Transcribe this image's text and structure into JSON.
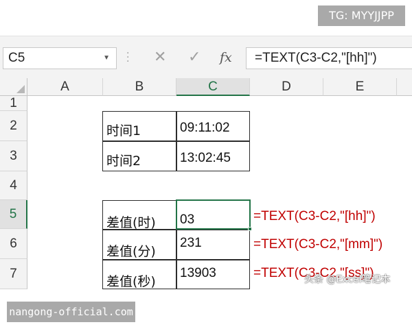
{
  "watermarks": {
    "top_badge": "TG: MYYJJPP",
    "bottom_badge": "nangong-official.com",
    "corner_text": "头条 @Excel笔记本"
  },
  "formula_bar": {
    "name_box": "C5",
    "cancel_icon": "✕",
    "enter_icon": "✓",
    "fx_label": "fx",
    "formula": "=TEXT(C3-C2,\"[hh]\")"
  },
  "columns": [
    "A",
    "B",
    "C",
    "D",
    "E"
  ],
  "active_column": "C",
  "rows": [
    "1",
    "2",
    "3",
    "4",
    "5",
    "6",
    "7"
  ],
  "active_row": "5",
  "cells": {
    "B2": "时间1",
    "C2": "09:11:02",
    "B3": "时间2",
    "C3": "13:02:45",
    "B5": "差值(时)",
    "C5": "03",
    "B6": "差值(分)",
    "C6": "231",
    "B7": "差值(秒)",
    "C7": "13903"
  },
  "annotations": {
    "D5": "=TEXT(C3-C2,\"[hh]\")",
    "D6": "=TEXT(C3-C2,\"[mm]\")",
    "D7": "=TEXT(C3-C2,\"[ss]\")"
  },
  "colors": {
    "accent": "#217346",
    "annotation": "#c00000",
    "header_bg": "#f3f3f3"
  }
}
